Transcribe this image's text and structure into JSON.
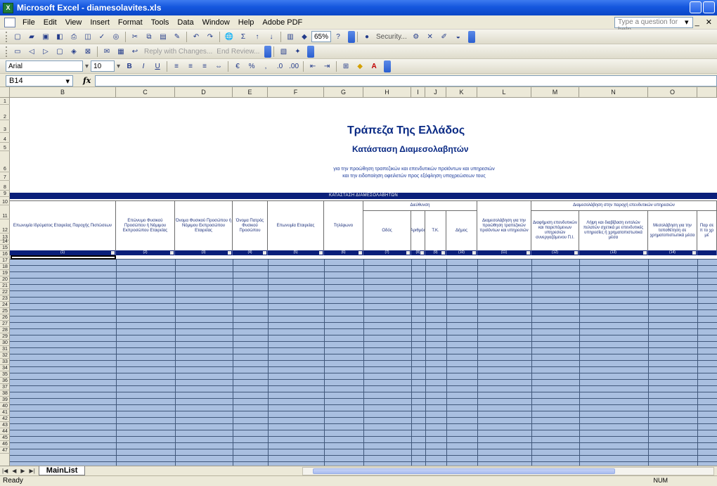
{
  "window": {
    "title": "Microsoft Excel - diamesolavites.xls",
    "app_icon": "excel-icon"
  },
  "menu": {
    "items": [
      "File",
      "Edit",
      "View",
      "Insert",
      "Format",
      "Tools",
      "Data",
      "Window",
      "Help",
      "Adobe PDF"
    ],
    "help_placeholder": "Type a question for help"
  },
  "toolbar1": {
    "zoom": "65%",
    "security_label": "Security..."
  },
  "toolbar2": {
    "reply_label": "Reply with Changes...",
    "end_review_label": "End Review..."
  },
  "format_bar": {
    "font": "Arial",
    "size": "10"
  },
  "formula_bar": {
    "cell_ref": "B14",
    "fx": "fx",
    "value": ""
  },
  "columns": [
    "B",
    "C",
    "D",
    "E",
    "F",
    "G",
    "H",
    "I",
    "J",
    "K",
    "L",
    "M",
    "N",
    "O"
  ],
  "rows": [
    "1",
    "2",
    "3",
    "4",
    "5",
    "6",
    "7",
    "8",
    "9",
    "10",
    "11",
    "12",
    "13",
    "14",
    "15",
    "16",
    "17",
    "18",
    "19",
    "20",
    "21",
    "22",
    "23",
    "24",
    "25",
    "26",
    "27",
    "28",
    "29",
    "30",
    "31",
    "32",
    "33",
    "34",
    "35",
    "36",
    "37",
    "38",
    "39",
    "40",
    "41",
    "42",
    "43",
    "44",
    "45",
    "46",
    "47"
  ],
  "sheet": {
    "title": "Τράπεζα Της Ελλάδος",
    "subtitle": "Κατάσταση Διαμεσολαβητών",
    "description_line1": "για την προώθηση τραπεζικών και επενδυτικών προϊόντων και υπηρεσιών",
    "description_line2": "και την ειδοποίηση οφειλετών προς εξόφληση υποχρεώσεων τους",
    "band_label": "ΚΑΤΑΣΤΑΣΗ ΔΙΑΜΕΣΟΛΑΒΗΤΩΝ",
    "address_group": "Διεύθυνση",
    "mediation_group": "Διαμεσολάβηση στην παροχή επενδυτικών υπηρεσιών",
    "headers": {
      "b": "Επωνυμία Ιδρύματος Εταιρείας Παροχής Πιστώσεων",
      "c": "Επώνυμο Φυσικού Προσώπου ή Νόμιμου Εκπροσώπου Εταιρείας",
      "d": "Όνομα Φυσικού Προσώπου ή Νόμιμου Εκπροσώπου Εταιρείας",
      "e": "Όνομα Πατρός Φυσικού Προσώπου",
      "f": "Επωνυμία Εταιρείας",
      "g": "Τηλέφωνο",
      "h": "Οδός",
      "i": "Αριθμός",
      "j": "Τ.Κ.",
      "k": "Δήμος",
      "l": "Διαμεσολάβηση για την προώθηση τραπεζικών προϊόντων και υπηρεσιών",
      "m": "Διαφήμιση επενδυτικών και παρεπόμενων υπηρεσιών συνεργαζόμενου Π.Ι.",
      "n": "Λήψη και διαβίβαση εντολών πελατών σχετικά με επενδυτικές υπηρεσίες ή χρηματοπιστωτικά μέσα",
      "o": "Μεσολάβηση για την τοποθέτηση σε χρηματοπιστωτικά μέσα",
      "p": "Παρ σε π το χρ μέ"
    },
    "numbers": [
      "(1)",
      "(2)",
      "(3)",
      "(4)",
      "(5)",
      "(6)",
      "(7)",
      "(8)",
      "(9)",
      "(10)",
      "(11)",
      "(12)",
      "(13)",
      "(14)"
    ]
  },
  "sheet_tab": "MainList",
  "status": {
    "text": "Ready",
    "num": "NUM"
  }
}
